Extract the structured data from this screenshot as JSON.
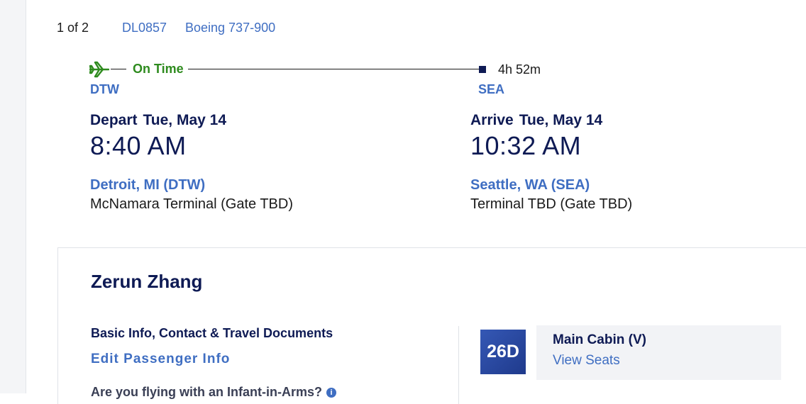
{
  "segment": {
    "count": "1 of 2",
    "flight_number": "DL0857",
    "aircraft": "Boeing 737-900"
  },
  "timeline": {
    "status": "On Time",
    "duration": "4h 52m",
    "origin_code": "DTW",
    "dest_code": "SEA",
    "status_color": "#2e8b1e"
  },
  "depart": {
    "label": "Depart",
    "date": "Tue, May 14",
    "time": "8:40 AM",
    "city": "Detroit, MI (DTW)",
    "terminal": "McNamara Terminal (Gate TBD)"
  },
  "arrive": {
    "label": "Arrive",
    "date": "Tue, May 14",
    "time": "10:32 AM",
    "city": "Seattle, WA (SEA)",
    "terminal": "Terminal TBD (Gate TBD)"
  },
  "passenger": {
    "name": "Zerun Zhang",
    "basic_info_heading": "Basic Info, Contact & Travel Documents",
    "edit_link": "Edit Passenger Info",
    "infant_question": "Are you flying with an Infant-in-Arms?",
    "seat": "26D",
    "cabin": "Main Cabin (V)",
    "view_seats": "View Seats"
  },
  "icons": {
    "plane": "airplane-icon",
    "info": "info-circle-icon"
  }
}
